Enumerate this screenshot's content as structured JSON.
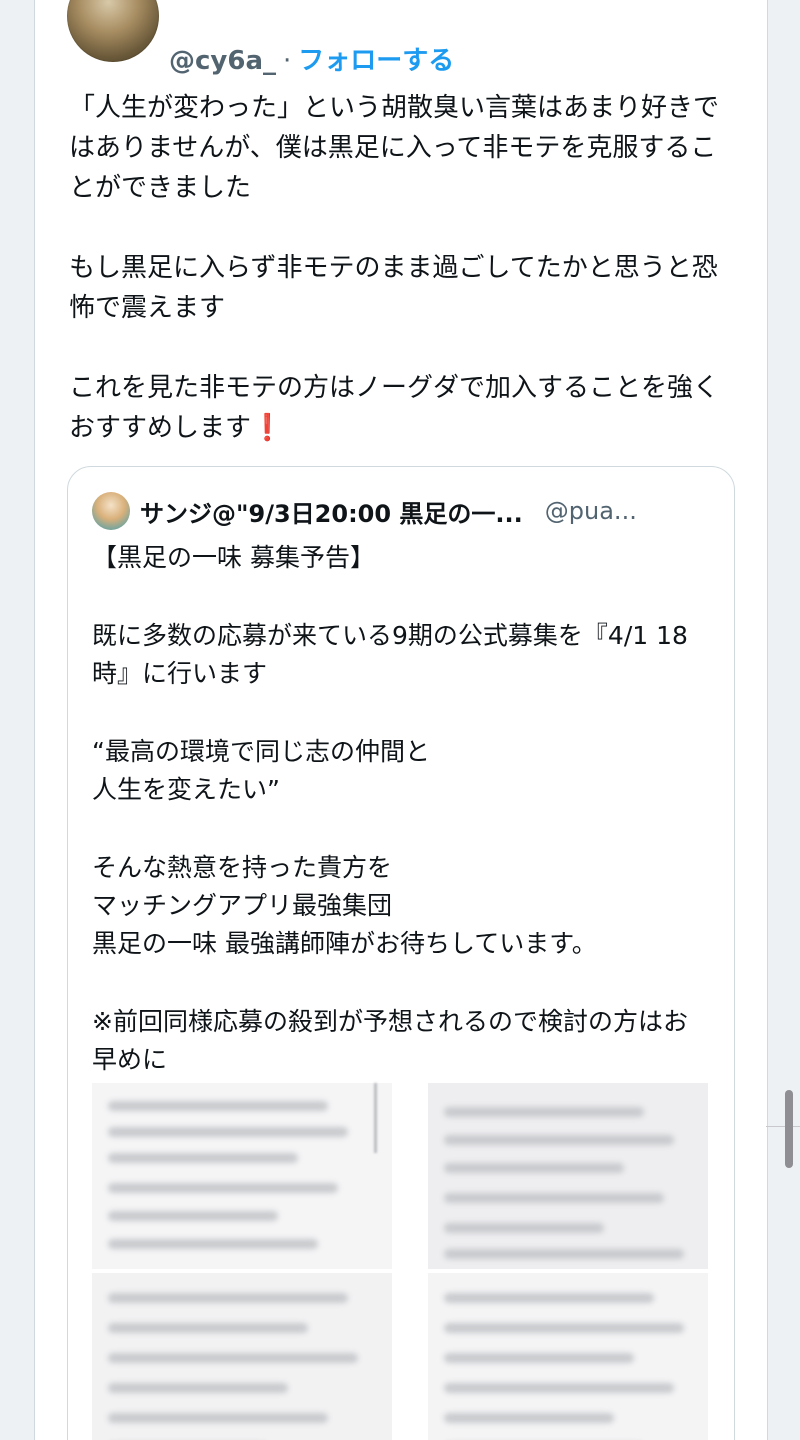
{
  "tweet": {
    "author_handle": "@cy6a_",
    "separator": "·",
    "follow_label": "フォローする",
    "paragraphs": [
      "「人生が変わった」という胡散臭い言葉はあまり好きではありませんが、僕は黒足に入って非モテを克服することができました",
      "もし黒足に入らず非モテのまま過ごしてたかと思うと恐怖で震えます",
      "これを見た非モテの方はノーグダで加入することを強くおすすめします"
    ],
    "emoji": "❗"
  },
  "quote": {
    "author_name": "サンジ@\"9/3日20:00 黒足の一...",
    "author_handle": "@pua...",
    "paragraphs": [
      "【黒足の一味 募集予告】",
      "既に多数の応募が来ている9期の公式募集を『4/1 18時』に行います",
      "“最高の環境で同じ志の仲間と\n人生を変えたい”",
      "そんな熱意を持った貴方を\nマッチングアプリ最強集団\n黒足の一味 最強講師陣がお待ちしています。",
      "※前回同様応募の殺到が予想されるので検討の方はお早めに"
    ]
  },
  "colors": {
    "link_blue": "#1d9bf0",
    "secondary_text": "#536471",
    "border": "#cfd9de",
    "emoji_red": "#d22a2a"
  },
  "icons": {
    "author_avatar": "avatar-icon",
    "twitter_logo": "twitter-bird-icon"
  }
}
